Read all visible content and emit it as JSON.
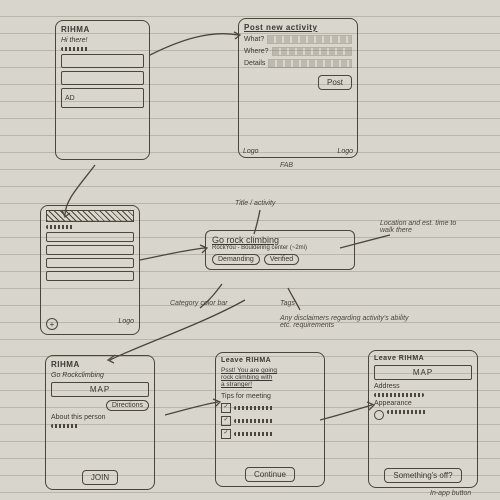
{
  "app_name": "RIHMA",
  "screens": {
    "home": {
      "title": "RIHMA",
      "greeting": "Hi there!",
      "card3": "AD",
      "logo": "Logo"
    },
    "post": {
      "heading": "Post new activity",
      "f1": "What?",
      "f2": "Where?",
      "f3": "Details",
      "submit": "Post",
      "fab": "FAB",
      "logo": "Logo"
    },
    "feed": {
      "logo": "Logo"
    },
    "detail_card": {
      "title": "Go rock climbing",
      "subtitle": "RockYou - Bouldering center (~2mi)",
      "tag1": "Demanding",
      "tag2": "Verified"
    },
    "detail_screen": {
      "title": "RIHMA",
      "activity": "Go Rockclimbing",
      "map": "MAP",
      "directions": "Directions",
      "about": "About this person",
      "join": "JOIN"
    },
    "leave1": {
      "title": "Leave RIHMA",
      "warn1": "Psst! You are going",
      "warn2": "rock climbing with",
      "warn3": "a stranger!",
      "tips": "Tips for meeting",
      "continue": "Continue"
    },
    "leave2": {
      "title": "Leave RIHMA",
      "map": "MAP",
      "address": "Address",
      "appearance": "Appearance",
      "sos": "Something's off?",
      "note": "In-app button"
    }
  },
  "annotations": {
    "title_activity": "Title / activity",
    "category": "Category color bar",
    "tags": "Tags",
    "disclaimer": "Any disclaimers regarding activity's ability etc. requirements",
    "loc": "Location and est. time to walk there"
  }
}
